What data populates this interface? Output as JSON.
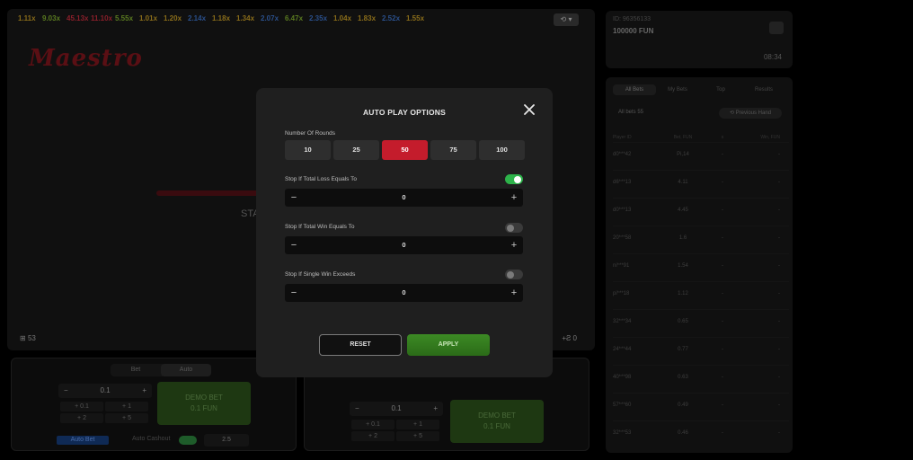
{
  "history": [
    {
      "v": "1.11x",
      "c": "#8a6d1a"
    },
    {
      "v": "9.03x",
      "c": "#5a7a20"
    },
    {
      "v": "45.13x",
      "c": "#8a1f2a"
    },
    {
      "v": "11.10x",
      "c": "#8a1f2a"
    },
    {
      "v": "5.55x",
      "c": "#5a7a20"
    },
    {
      "v": "1.01x",
      "c": "#8a6d1a"
    },
    {
      "v": "1.20x",
      "c": "#8a6d1a"
    },
    {
      "v": "2.14x",
      "c": "#2a4f8a"
    },
    {
      "v": "1.18x",
      "c": "#8a6d1a"
    },
    {
      "v": "1.34x",
      "c": "#8a6d1a"
    },
    {
      "v": "2.07x",
      "c": "#2a4f8a"
    },
    {
      "v": "6.47x",
      "c": "#5a7a20"
    },
    {
      "v": "2.35x",
      "c": "#2a4f8a"
    },
    {
      "v": "1.04x",
      "c": "#8a6d1a"
    },
    {
      "v": "1.83x",
      "c": "#8a6d1a"
    },
    {
      "v": "2.52x",
      "c": "#2a4f8a"
    },
    {
      "v": "1.55x",
      "c": "#8a6d1a"
    }
  ],
  "game": {
    "logo": "Maestro",
    "start_text": "STA",
    "left_counter": "53",
    "right_counter": "0"
  },
  "panel1": {
    "tab_bet": "Bet",
    "tab_auto": "Auto",
    "amount": "0.1",
    "quick": [
      "+ 0.1",
      "+ 1",
      "+ 2",
      "+ 5"
    ],
    "bet_line1": "DEMO BET",
    "bet_line2": "0.1 FUN",
    "auto_bet": "Auto Bet",
    "auto_cashout": "Auto Cashout",
    "cashout_value": "2.5"
  },
  "panel2": {
    "amount": "0.1",
    "quick": [
      "+ 0.1",
      "+ 1",
      "+ 2",
      "+ 5"
    ],
    "bet_line1": "DEMO BET",
    "bet_line2": "0.1 FUN"
  },
  "account": {
    "id": "ID: 96356133",
    "balance": "100000 FUN",
    "time": "08:34"
  },
  "bets": {
    "tabs": [
      "All Bets",
      "My Bets",
      "Top",
      "Results"
    ],
    "all_bets_count": "All bets 55",
    "previous_hand": "Previous Hand",
    "headers": [
      "Player ID",
      "Bet, FUN",
      "x",
      "Win, FUN"
    ],
    "rows": [
      [
        "d0***42",
        "Pi,14",
        "-",
        "-"
      ],
      [
        "d6***13",
        "4.11",
        "-",
        "-"
      ],
      [
        "d0***13",
        "4.45",
        "-",
        "-"
      ],
      [
        "20***58",
        "1.6",
        "-",
        "-"
      ],
      [
        "ni***91",
        "1.54",
        "-",
        "-"
      ],
      [
        "pi***18",
        "1.12",
        "-",
        "-"
      ],
      [
        "32***34",
        "0.65",
        "-",
        "-"
      ],
      [
        "24***44",
        "0.77",
        "-",
        "-"
      ],
      [
        "40***98",
        "0.63",
        "-",
        "-"
      ],
      [
        "57***60",
        "0.49",
        "-",
        "-"
      ],
      [
        "32***53",
        "0.46",
        "-",
        "-"
      ]
    ]
  },
  "modal": {
    "title": "AUTO PLAY OPTIONS",
    "rounds_label": "Number Of Rounds",
    "rounds": [
      "10",
      "25",
      "50",
      "75",
      "100"
    ],
    "selected_round": "50",
    "loss_label": "Stop If Total Loss Equals To",
    "loss_toggle": true,
    "loss_value": "0",
    "win_label": "Stop If Total Win Equals To",
    "win_toggle": false,
    "win_value": "0",
    "single_label": "Stop If Single Win Exceeds",
    "single_toggle": false,
    "single_value": "0",
    "reset_label": "RESET",
    "apply_label": "APPLY"
  },
  "colors": {
    "accent_red": "#c41c2c",
    "apply_green": "#3c8a24",
    "toggle_on": "#2db34a"
  }
}
